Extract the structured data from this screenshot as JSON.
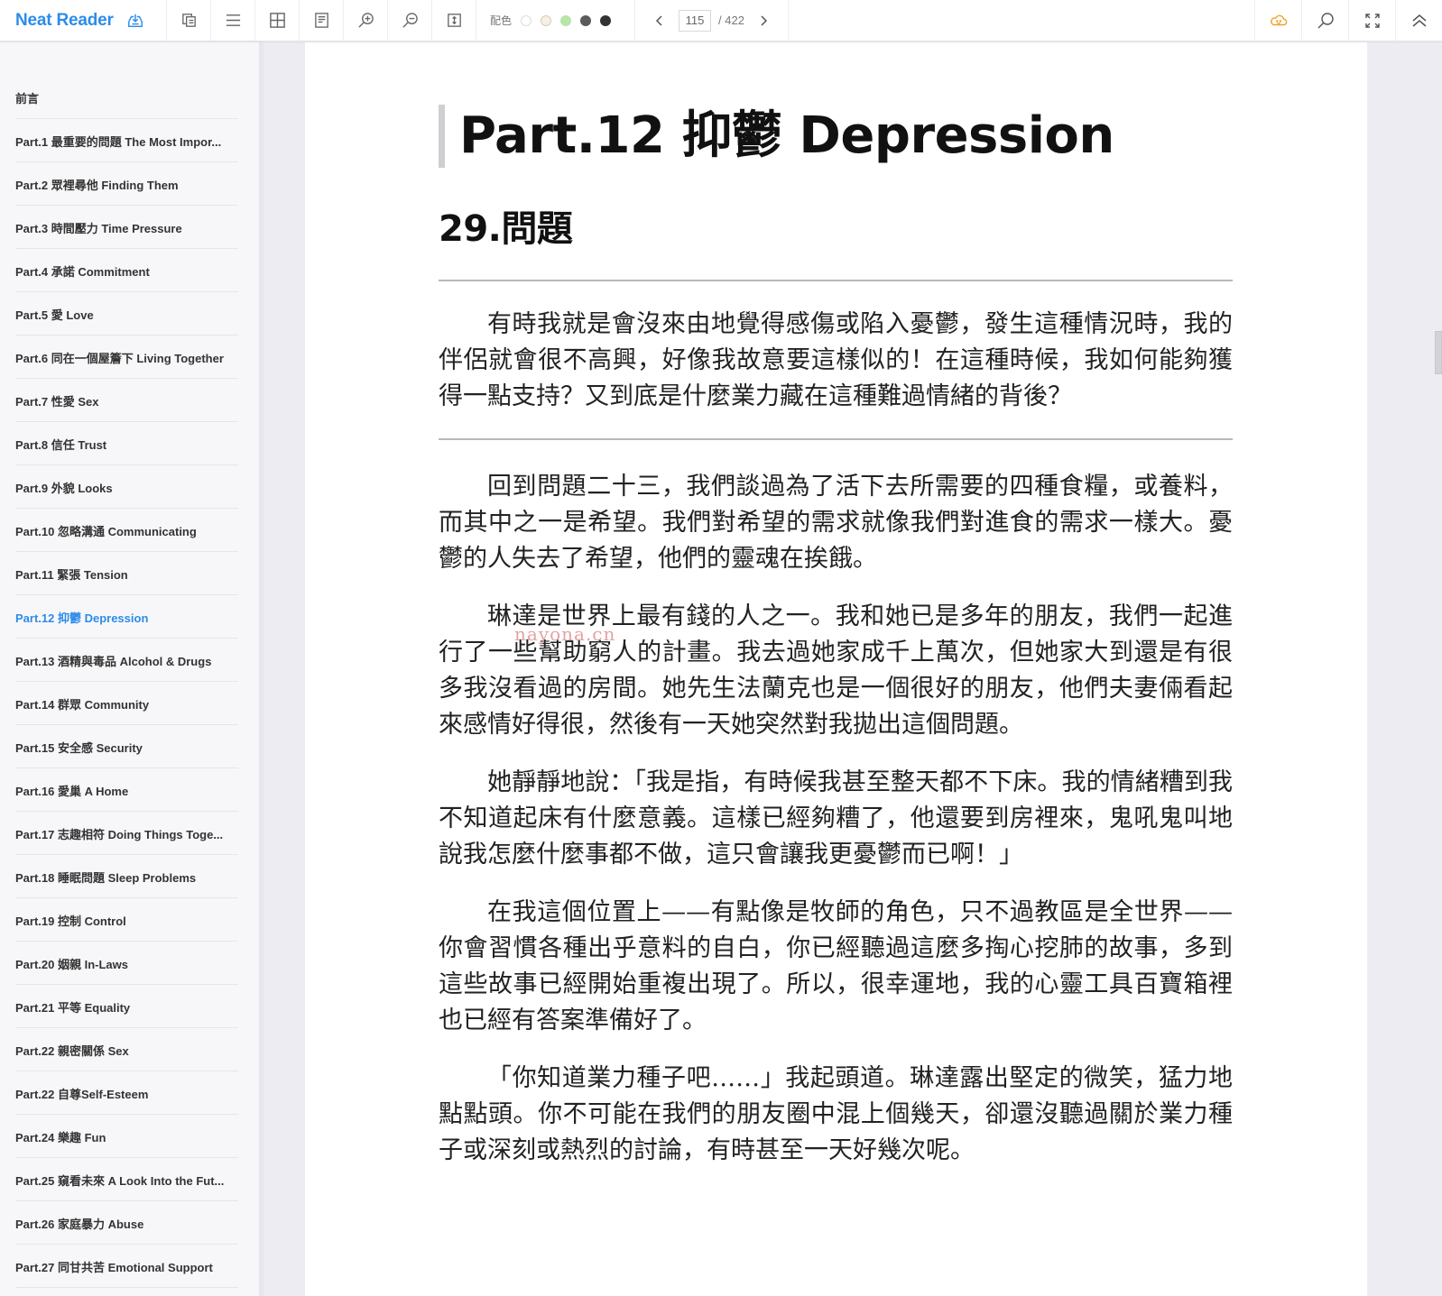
{
  "app": {
    "name": "Neat Reader"
  },
  "toolbar": {
    "buttons": [
      {
        "name": "save-icon",
        "label": "save"
      },
      {
        "name": "copy-icon",
        "label": "copy"
      },
      {
        "name": "menu-icon",
        "label": "table of contents"
      },
      {
        "name": "grid-icon",
        "label": "layout"
      },
      {
        "name": "note-icon",
        "label": "notes"
      },
      {
        "name": "zoom-in-icon",
        "label": "zoom in"
      },
      {
        "name": "zoom-out-icon",
        "label": "zoom out"
      },
      {
        "name": "fit-height-icon",
        "label": "fit"
      }
    ],
    "palette": {
      "label": "配色",
      "swatches": [
        "#ffffff",
        "#f7efe3",
        "#b9e5a8",
        "#5b5b5b",
        "#333333"
      ]
    },
    "pager": {
      "current_page": "115",
      "total_pages": "/ 422"
    },
    "right_buttons": [
      "cloud-sync-icon",
      "search-icon",
      "fullscreen-icon",
      "collapse-up-icon"
    ],
    "cloud_color": "#f0a020"
  },
  "sidebar": {
    "items": [
      {
        "label": "前言"
      },
      {
        "label": "Part.1 最重要的問題 The Most Impor..."
      },
      {
        "label": "Part.2 眾裡尋他 Finding Them"
      },
      {
        "label": "Part.3 時間壓力 Time Pressure"
      },
      {
        "label": "Part.4 承諾 Commitment"
      },
      {
        "label": "Part.5 愛 Love"
      },
      {
        "label": "Part.6 同在一個屋簷下 Living Together"
      },
      {
        "label": "Part.7 性愛 Sex"
      },
      {
        "label": "Part.8 信任 Trust"
      },
      {
        "label": "Part.9 外貌 Looks"
      },
      {
        "label": "Part.10 忽略溝通 Communicating"
      },
      {
        "label": "Part.11 緊張 Tension"
      },
      {
        "label": "Part.12 抑鬱 Depression",
        "active": true
      },
      {
        "label": "Part.13 酒精與毒品 Alcohol & Drugs"
      },
      {
        "label": "Part.14 群眾 Community"
      },
      {
        "label": "Part.15 安全感 Security"
      },
      {
        "label": "Part.16 愛巢 A Home"
      },
      {
        "label": "Part.17 志趣相符 Doing Things Toge..."
      },
      {
        "label": "Part.18 睡眠問題 Sleep Problems"
      },
      {
        "label": "Part.19 控制 Control"
      },
      {
        "label": "Part.20 姻親 In-Laws"
      },
      {
        "label": "Part.21 平等 Equality"
      },
      {
        "label": "Part.22 親密關係 Sex"
      },
      {
        "label": "Part.22 自尊Self-Esteem"
      },
      {
        "label": "Part.24 樂趣 Fun"
      },
      {
        "label": "Part.25 窺看未來 A Look Into the Fut..."
      },
      {
        "label": "Part.26 家庭暴力 Abuse"
      },
      {
        "label": "Part.27 同甘共苦 Emotional Support"
      }
    ]
  },
  "document": {
    "part_title": "Part.12 抑鬱 Depression",
    "section_title": "29.問題",
    "question": "有時我就是會沒來由地覺得感傷或陷入憂鬱，發生這種情況時，我的伴侶就會很不高興，好像我故意要這樣似的！在這種時候，我如何能夠獲得一點支持？又到底是什麼業力藏在這種難過情緒的背後？",
    "paragraphs": [
      "回到問題二十三，我們談過為了活下去所需要的四種食糧，或養料，而其中之一是希望。我們對希望的需求就像我們對進食的需求一樣大。憂鬱的人失去了希望，他們的靈魂在挨餓。",
      "琳達是世界上最有錢的人之一。我和她已是多年的朋友，我們一起進行了一些幫助窮人的計畫。我去過她家成千上萬次，但她家大到還是有很多我沒看過的房間。她先生法蘭克也是一個很好的朋友，他們夫妻倆看起來感情好得很，然後有一天她突然對我拋出這個問題。",
      "她靜靜地說：「我是指，有時候我甚至整天都不下床。我的情緒糟到我不知道起床有什麼意義。這樣已經夠糟了，他還要到房裡來，鬼吼鬼叫地說我怎麼什麼事都不做，這只會讓我更憂鬱而已啊！」",
      "在我這個位置上——有點像是牧師的角色，只不過教區是全世界——你會習慣各種出乎意料的自白，你已經聽過這麼多掏心挖肺的故事，多到這些故事已經開始重複出現了。所以，很幸運地，我的心靈工具百寶箱裡也已經有答案準備好了。",
      "「你知道業力種子吧……」我起頭道。琳達露出堅定的微笑，猛力地點點頭。你不可能在我們的朋友圈中混上個幾天，卻還沒聽過關於業力種子或深刻或熱烈的討論，有時甚至一天好幾次呢。"
    ],
    "watermark": "nayona.cn"
  }
}
